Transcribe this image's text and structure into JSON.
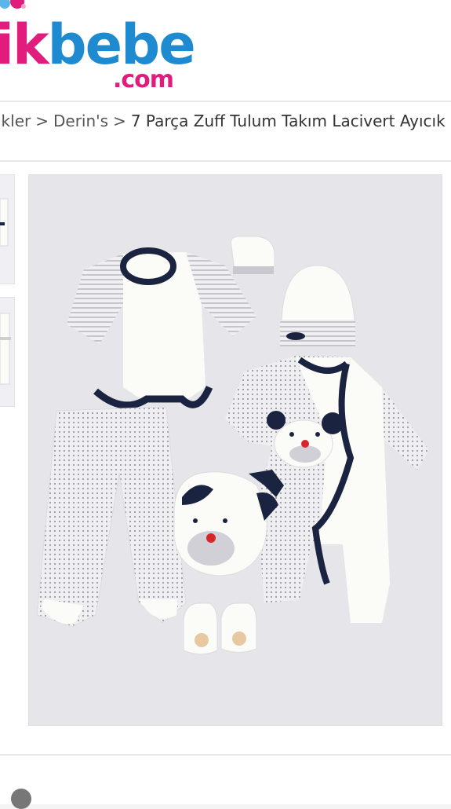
{
  "logo": {
    "part1": "ikbebe",
    "part1_pink": "ik",
    "part1_blue": "bebe",
    "sub": ".com",
    "pink": "#e21c7c",
    "blue": "#1e8bd0"
  },
  "breadcrumb": {
    "items": [
      "ikler",
      "Derin's",
      "7 Parça Zuff Tulum Takım Lacivert Ayıcık"
    ],
    "separator": ">"
  },
  "product_image": {
    "icon": "baby-clothing-set-photo",
    "colors": {
      "navy": "#1a2340",
      "white": "#fbfbf8",
      "grey": "#cfcfd2",
      "red": "#d6262b"
    }
  },
  "thumbnails": {
    "count": 2
  }
}
